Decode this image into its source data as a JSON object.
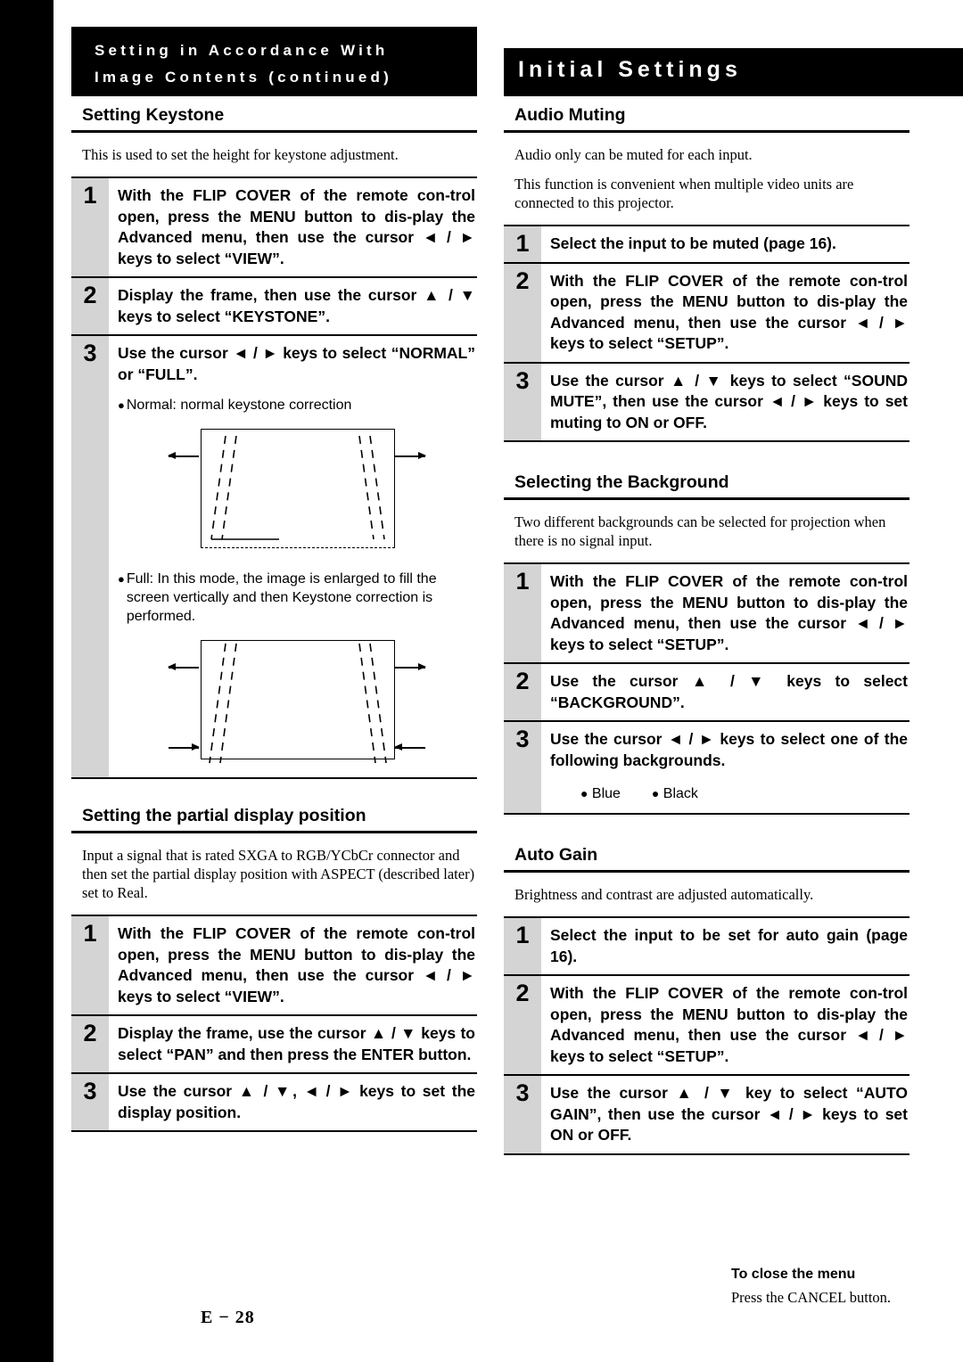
{
  "header": {
    "left_line1": "Setting in Accordance With",
    "left_line2": "Image Contents (continued)",
    "right_title": "Initial Settings"
  },
  "left_column": {
    "sections": [
      {
        "heading": "Setting Keystone",
        "intro": "This is used to set the height for keystone adjustment.",
        "steps": [
          {
            "num": "1",
            "text": "With the FLIP COVER of the remote con-trol open, press the MENU button to dis-play the Advanced menu, then use the cursor ◄ / ► keys to select “VIEW”."
          },
          {
            "num": "2",
            "text": "Display the frame, then use the cursor ▲ / ▼ keys to select “KEYSTONE”."
          },
          {
            "num": "3",
            "text": "Use the cursor ◄ / ► keys to select “NORMAL” or “FULL”."
          }
        ],
        "notes": [
          "Normal: normal keystone correction",
          "Full: In this mode, the image is enlarged to fill the screen vertically and then Keystone correction is performed."
        ]
      },
      {
        "heading": "Setting the partial display position",
        "intro": "Input a signal that is rated SXGA to RGB/YCbCr connector and then set the partial display position with ASPECT (described later) set to Real.",
        "steps": [
          {
            "num": "1",
            "text": "With the FLIP COVER of the remote con-trol open, press the MENU button to dis-play the Advanced menu, then use the cursor ◄ / ► keys to select “VIEW”."
          },
          {
            "num": "2",
            "text": "Display the frame, use the cursor ▲ / ▼ keys to select “PAN” and then press the ENTER button."
          },
          {
            "num": "3",
            "text": "Use the cursor ▲ / ▼, ◄ / ► keys to set the display position."
          }
        ]
      }
    ]
  },
  "right_column": {
    "sections": [
      {
        "heading": "Audio Muting",
        "intro1": "Audio only can be muted for each input.",
        "intro2": "This function is convenient when multiple video units are connected to this projector.",
        "steps": [
          {
            "num": "1",
            "text": "Select the input to be muted (page 16)."
          },
          {
            "num": "2",
            "text": "With the FLIP COVER of the remote con-trol open, press the MENU button to dis-play the Advanced menu, then use the cursor ◄ / ► keys to select “SETUP”."
          },
          {
            "num": "3",
            "text": "Use the cursor ▲ / ▼ keys to select “SOUND MUTE”, then use the cursor ◄ / ► keys to set muting to ON or OFF."
          }
        ]
      },
      {
        "heading": "Selecting the Background",
        "intro1": "Two different backgrounds can be selected for projection when there is no signal input.",
        "steps": [
          {
            "num": "1",
            "text": "With the FLIP COVER of the remote con-trol open, press the MENU button to dis-play the Advanced menu, then use the cursor ◄ / ► keys to select “SETUP”."
          },
          {
            "num": "2",
            "text": "Use the cursor ▲ / ▼ keys to select “BACKGROUND”."
          },
          {
            "num": "3",
            "text": "Use the cursor ◄ / ► keys to select one of the following backgrounds."
          }
        ],
        "background_options": [
          "Blue",
          "Black"
        ]
      },
      {
        "heading": "Auto Gain",
        "intro1": "Brightness and contrast are adjusted automatically.",
        "steps": [
          {
            "num": "1",
            "text": "Select the input to be set for auto gain (page 16)."
          },
          {
            "num": "2",
            "text": "With the FLIP COVER of the remote con-trol open, press the MENU button to dis-play the Advanced menu, then use the cursor ◄ / ► keys to select “SETUP”."
          },
          {
            "num": "3",
            "text": "Use the cursor ▲ / ▼ key to select “AUTO GAIN”, then use the cursor ◄ / ► keys to set ON or OFF."
          }
        ]
      }
    ]
  },
  "footer": {
    "page_number": "E − 28",
    "close_title": "To close the menu",
    "close_text": "Press the CANCEL button."
  }
}
